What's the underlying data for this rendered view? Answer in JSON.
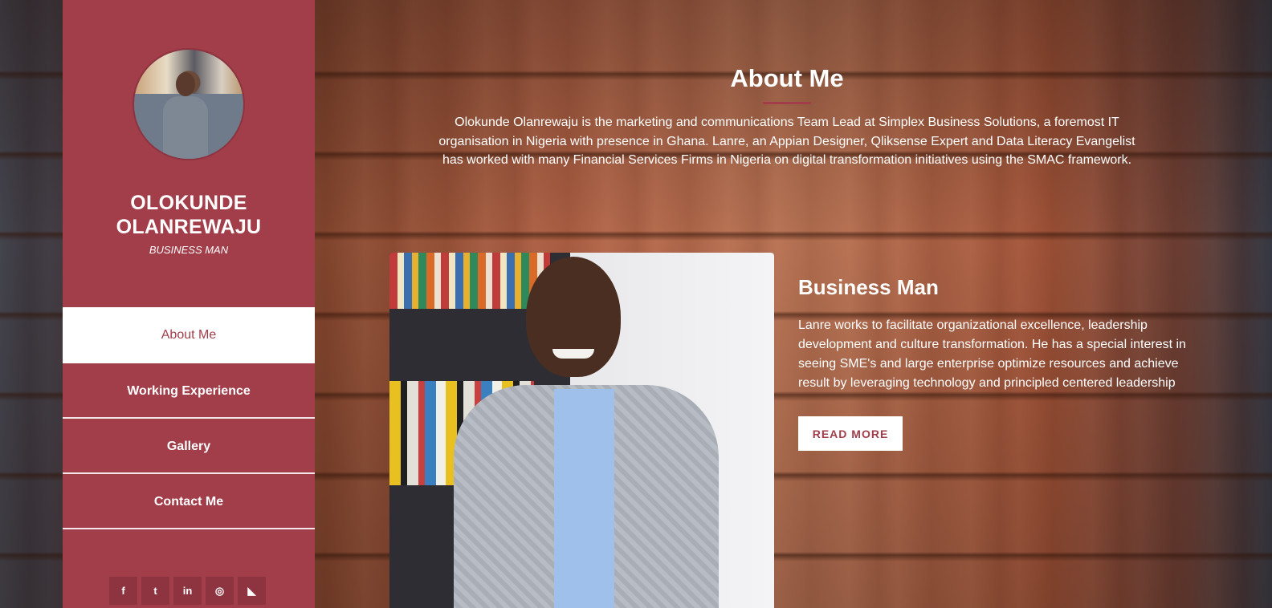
{
  "sidebar": {
    "name": "OLOKUNDE OLANREWAJU",
    "role": "BUSINESS MAN",
    "nav": [
      {
        "label": "About Me",
        "active": true
      },
      {
        "label": "Working Experience",
        "active": false
      },
      {
        "label": "Gallery",
        "active": false
      },
      {
        "label": "Contact Me",
        "active": false
      }
    ],
    "socials": [
      {
        "icon": "facebook-icon",
        "glyph": "f"
      },
      {
        "icon": "twitter-icon",
        "glyph": "t"
      },
      {
        "icon": "linkedin-icon",
        "glyph": "in"
      },
      {
        "icon": "dribbble-icon",
        "glyph": "◎"
      },
      {
        "icon": "rss-icon",
        "glyph": "◣"
      }
    ]
  },
  "main": {
    "title": "About Me",
    "intro": "Olokunde Olanrewaju is the marketing and communications Team Lead at Simplex Business Solutions, a foremost IT organisation in Nigeria with presence in Ghana. Lanre, an Appian Designer, Qliksense Expert and Data Literacy Evangelist has worked with many Financial Services Firms in Nigeria on digital transformation initiatives using the SMAC framework.",
    "feature": {
      "title": "Business Man",
      "text": "Lanre works to facilitate organizational excellence, leadership development and culture transformation. He has a special interest in seeing SME's and large enterprise optimize resources and achieve result by leveraging technology and principled centered leadership",
      "button": "READ MORE"
    }
  },
  "colors": {
    "accent": "#a23d4a",
    "white": "#ffffff"
  }
}
